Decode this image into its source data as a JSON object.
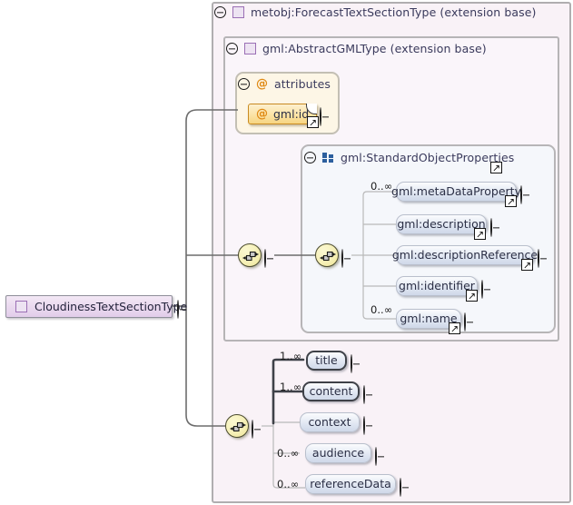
{
  "diagram": {
    "kind": "xsd-schema-diagram",
    "root": {
      "label": "CloudinessTextSectionType",
      "icon": "complex-type-square-icon",
      "toggle": "minus"
    },
    "panels": {
      "forecast": {
        "label": "metobj:ForecastTextSectionType (extension base)",
        "toggle": "minus",
        "icon": "complex-type-square-icon"
      },
      "abstractgml": {
        "label": "gml:AbstractGMLType (extension base)",
        "toggle": "minus",
        "icon": "complex-type-square-icon"
      },
      "attributes": {
        "label": "attributes",
        "toggle": "minus",
        "icon": "attribute-at-icon"
      },
      "standardobjectproperties": {
        "label": "gml:StandardObjectProperties",
        "toggle": "minus",
        "icon": "model-group-icon",
        "reference": true
      }
    },
    "attributes_list": [
      {
        "name": "gml:id",
        "icon": "attribute-at-icon",
        "toggle": "plus",
        "reference": true,
        "folded_corner": true
      }
    ],
    "group_elements": [
      {
        "name": "gml:metaDataProperty",
        "cardinality": "0..∞",
        "required": false,
        "reference": true,
        "toggle": "plus"
      },
      {
        "name": "gml:description",
        "cardinality": "",
        "required": false,
        "reference": true,
        "toggle": "plus"
      },
      {
        "name": "gml:descriptionReference",
        "cardinality": "",
        "required": false,
        "reference": true,
        "toggle": "plus"
      },
      {
        "name": "gml:identifier",
        "cardinality": "",
        "required": false,
        "reference": true,
        "toggle": "plus"
      },
      {
        "name": "gml:name",
        "cardinality": "0..∞",
        "required": false,
        "reference": true,
        "toggle": "plus"
      }
    ],
    "section_elements": [
      {
        "name": "title",
        "cardinality": "1..∞",
        "required": true,
        "reference": false,
        "toggle": "plus"
      },
      {
        "name": "content",
        "cardinality": "1..∞",
        "required": true,
        "reference": false,
        "toggle": "plus"
      },
      {
        "name": "context",
        "cardinality": "",
        "required": false,
        "reference": false,
        "toggle": "plus"
      },
      {
        "name": "audience",
        "cardinality": "0..∞",
        "required": false,
        "reference": false,
        "toggle": "plus"
      },
      {
        "name": "referenceData",
        "cardinality": "0..∞",
        "required": false,
        "reference": false,
        "toggle": "plus"
      }
    ],
    "compositors": [
      {
        "id": "seq-gml",
        "type": "sequence",
        "toggle": "minus"
      },
      {
        "id": "seq-group",
        "type": "sequence",
        "toggle": "minus"
      },
      {
        "id": "seq-section",
        "type": "sequence",
        "toggle": "minus"
      }
    ],
    "colors": {
      "panel_outer_bg": "#f9f2f7",
      "panel_mid_bg": "#faf5fa",
      "panel_attr_bg": "#fdf6e6",
      "panel_group_bg": "#f5f7fb",
      "element_fill": "#e7ecf5",
      "attribute_fill": "#fbe3a6",
      "root_fill": "#ead9ef",
      "compositor_fill": "#f5efb4",
      "type_icon_border": "#9b6fb5",
      "group_icon": "#2c5f9e",
      "at_icon": "#e08b16",
      "wire": "#6d6d6d",
      "wire_light": "#b9b9b9"
    }
  }
}
